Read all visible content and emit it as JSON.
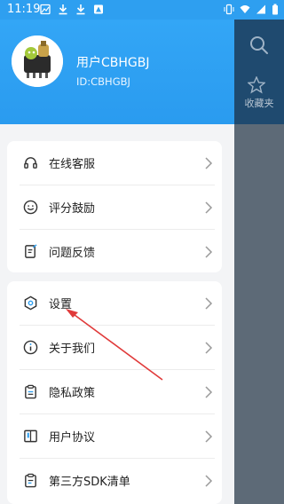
{
  "status_bar": {
    "time": "11:19"
  },
  "user": {
    "name": "用户CBHGBJ",
    "id": "ID:CBHGBJ"
  },
  "menu_group_1": [
    {
      "label": "在线客服",
      "icon": "headset-icon"
    },
    {
      "label": "评分鼓励",
      "icon": "smiley-icon"
    },
    {
      "label": "问题反馈",
      "icon": "feedback-icon"
    }
  ],
  "menu_group_2": [
    {
      "label": "设置",
      "icon": "settings-icon"
    },
    {
      "label": "关于我们",
      "icon": "info-icon"
    },
    {
      "label": "隐私政策",
      "icon": "clipboard-icon"
    },
    {
      "label": "用户协议",
      "icon": "book-icon"
    },
    {
      "label": "第三方SDK清单",
      "icon": "list-icon"
    }
  ],
  "background_app": {
    "favorites_label": "收藏夹"
  },
  "colors": {
    "header_blue": "#2e9ff0",
    "annotation_red": "#e03a3a"
  }
}
